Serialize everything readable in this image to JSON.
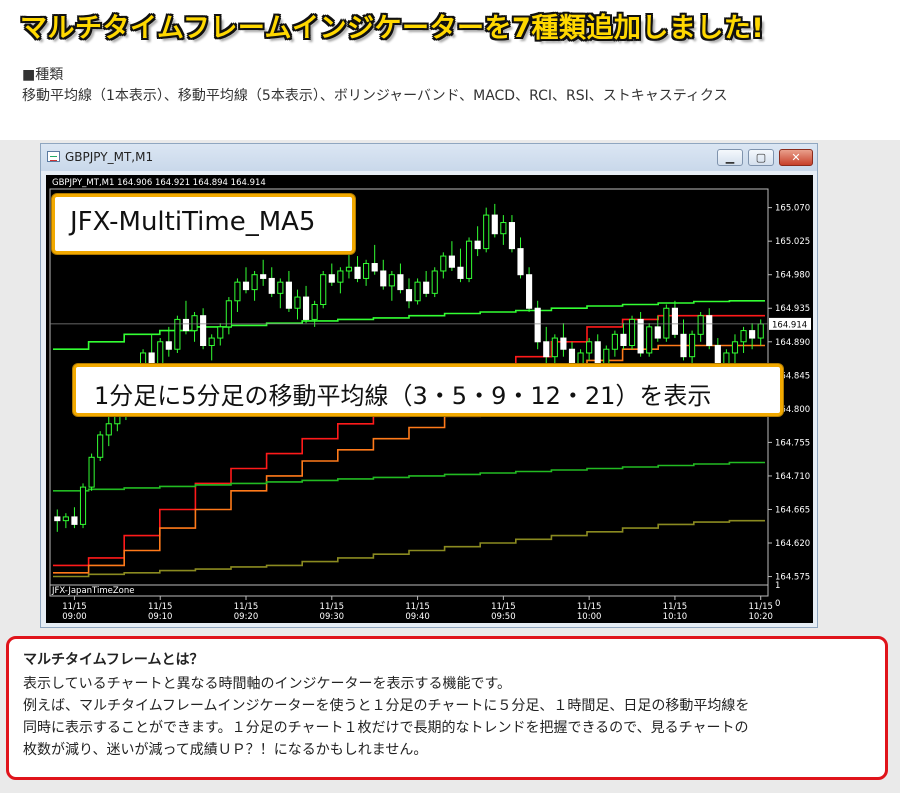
{
  "page": {
    "headline": "マルチタイムフレームインジケーターを7種類追加しました!",
    "types_heading": "■種類",
    "types_list": "移動平均線（1本表示）、移動平均線（5本表示）、ボリンジャーバンド、MACD、RCI、RSI、ストキャスティクス"
  },
  "window": {
    "title": "GBPJPY_MT,M1",
    "buttons": {
      "minimize": "▁",
      "maximize": "▢",
      "close": "✕"
    }
  },
  "callouts": {
    "indicator_name": "JFX-MultiTime_MA5",
    "description": "1分足に5分足の移動平均線（3・5・9・12・21）を表示"
  },
  "info": {
    "title": "マルチタイムフレームとは？",
    "lines": [
      "表示しているチャートと異なる時間軸のインジケーターを表示する機能です。",
      "例えば、マルチタイムフレームインジケーターを使うと１分足のチャートに５分足、１時間足、日足の移動平均線を",
      "同時に表示することができます。１分足のチャート１枚だけで長期的なトレンドを把握できるので、見るチャートの",
      "枚数が減り、迷いが減って成績ＵＰ？！になるかもしれません。"
    ]
  },
  "chart_data": {
    "type": "candlestick",
    "symbol_header": "GBPJPY_MT,M1  164.906 164.921 164.894 164.914",
    "sub_window_label": "JFX-JapanTimeZone",
    "ylim": [
      164.565,
      165.095
    ],
    "y_ticks": [
      "165.070",
      "165.025",
      "164.980",
      "164.935",
      "164.890",
      "164.845",
      "164.800",
      "164.755",
      "164.710",
      "164.665",
      "164.620",
      "164.575"
    ],
    "sub_ticks": [
      "1",
      "0"
    ],
    "current_price": "164.914",
    "x_ticks": [
      {
        "date": "11/15",
        "time": "09:00"
      },
      {
        "date": "11/15",
        "time": "09:10"
      },
      {
        "date": "11/15",
        "time": "09:20"
      },
      {
        "date": "11/15",
        "time": "09:30"
      },
      {
        "date": "11/15",
        "time": "09:40"
      },
      {
        "date": "11/15",
        "time": "09:50"
      },
      {
        "date": "11/15",
        "time": "10:00"
      },
      {
        "date": "11/15",
        "time": "10:10"
      },
      {
        "date": "11/15",
        "time": "10:20"
      }
    ],
    "candles": [
      [
        164.655,
        164.665,
        164.635,
        164.65
      ],
      [
        164.65,
        164.66,
        164.64,
        164.655
      ],
      [
        164.655,
        164.668,
        164.64,
        164.645
      ],
      [
        164.645,
        164.7,
        164.64,
        164.695
      ],
      [
        164.695,
        164.74,
        164.69,
        164.735
      ],
      [
        164.735,
        164.77,
        164.73,
        164.765
      ],
      [
        164.765,
        164.79,
        164.75,
        164.78
      ],
      [
        164.78,
        164.8,
        164.77,
        164.79
      ],
      [
        164.79,
        164.83,
        164.785,
        164.825
      ],
      [
        164.825,
        164.845,
        164.81,
        164.835
      ],
      [
        164.835,
        164.88,
        164.83,
        164.875
      ],
      [
        164.875,
        164.9,
        164.85,
        164.86
      ],
      [
        164.86,
        164.895,
        164.85,
        164.89
      ],
      [
        164.89,
        164.91,
        164.87,
        164.88
      ],
      [
        164.88,
        164.925,
        164.875,
        164.92
      ],
      [
        164.92,
        164.945,
        164.9,
        164.905
      ],
      [
        164.905,
        164.93,
        164.89,
        164.925
      ],
      [
        164.925,
        164.935,
        164.88,
        164.885
      ],
      [
        164.885,
        164.9,
        164.865,
        164.895
      ],
      [
        164.895,
        164.915,
        164.885,
        164.91
      ],
      [
        164.91,
        164.95,
        164.9,
        164.945
      ],
      [
        164.945,
        164.975,
        164.93,
        164.97
      ],
      [
        164.97,
        164.99,
        164.955,
        164.96
      ],
      [
        164.96,
        164.985,
        164.945,
        164.98
      ],
      [
        164.98,
        165.0,
        164.965,
        164.975
      ],
      [
        164.975,
        164.99,
        164.95,
        164.955
      ],
      [
        164.955,
        164.975,
        164.935,
        164.97
      ],
      [
        164.97,
        164.985,
        164.93,
        164.935
      ],
      [
        164.935,
        164.96,
        164.92,
        164.95
      ],
      [
        164.95,
        164.965,
        164.915,
        164.92
      ],
      [
        164.92,
        164.945,
        164.91,
        164.94
      ],
      [
        164.94,
        164.985,
        164.935,
        164.98
      ],
      [
        164.98,
        164.995,
        164.965,
        164.97
      ],
      [
        164.97,
        164.99,
        164.955,
        164.985
      ],
      [
        164.985,
        165.01,
        164.975,
        164.99
      ],
      [
        164.99,
        165.005,
        164.97,
        164.975
      ],
      [
        164.975,
        165.0,
        164.965,
        164.995
      ],
      [
        164.995,
        165.02,
        164.98,
        164.985
      ],
      [
        164.985,
        165.0,
        164.96,
        164.965
      ],
      [
        164.965,
        164.985,
        164.945,
        164.98
      ],
      [
        164.98,
        164.995,
        164.955,
        164.96
      ],
      [
        164.96,
        164.975,
        164.935,
        164.945
      ],
      [
        164.945,
        164.975,
        164.94,
        164.97
      ],
      [
        164.97,
        164.985,
        164.95,
        164.955
      ],
      [
        164.955,
        164.99,
        164.95,
        164.985
      ],
      [
        164.985,
        165.01,
        164.975,
        165.005
      ],
      [
        165.005,
        165.025,
        164.985,
        164.99
      ],
      [
        164.99,
        165.015,
        164.97,
        164.975
      ],
      [
        164.975,
        165.03,
        164.97,
        165.025
      ],
      [
        165.025,
        165.045,
        165.005,
        165.015
      ],
      [
        165.015,
        165.07,
        165.01,
        165.06
      ],
      [
        165.06,
        165.075,
        165.03,
        165.035
      ],
      [
        165.035,
        165.06,
        165.02,
        165.05
      ],
      [
        165.05,
        165.06,
        165.01,
        165.015
      ],
      [
        165.015,
        165.03,
        164.975,
        164.98
      ],
      [
        164.98,
        164.99,
        164.93,
        164.935
      ],
      [
        164.935,
        164.945,
        164.88,
        164.89
      ],
      [
        164.89,
        164.91,
        164.86,
        164.87
      ],
      [
        164.87,
        164.9,
        164.855,
        164.895
      ],
      [
        164.895,
        164.915,
        164.87,
        164.88
      ],
      [
        164.88,
        164.89,
        164.85,
        164.855
      ],
      [
        164.855,
        164.88,
        164.845,
        164.875
      ],
      [
        164.875,
        164.895,
        164.865,
        164.89
      ],
      [
        164.89,
        164.9,
        164.855,
        164.86
      ],
      [
        164.86,
        164.885,
        164.845,
        164.88
      ],
      [
        164.88,
        164.905,
        164.87,
        164.9
      ],
      [
        164.9,
        164.915,
        164.88,
        164.885
      ],
      [
        164.885,
        164.925,
        164.88,
        164.92
      ],
      [
        164.92,
        164.93,
        164.87,
        164.875
      ],
      [
        164.875,
        164.915,
        164.87,
        164.91
      ],
      [
        164.91,
        164.925,
        164.89,
        164.895
      ],
      [
        164.895,
        164.94,
        164.89,
        164.935
      ],
      [
        164.935,
        164.945,
        164.895,
        164.9
      ],
      [
        164.9,
        164.92,
        164.865,
        164.87
      ],
      [
        164.87,
        164.905,
        164.86,
        164.9
      ],
      [
        164.9,
        164.93,
        164.89,
        164.925
      ],
      [
        164.925,
        164.935,
        164.88,
        164.885
      ],
      [
        164.885,
        164.895,
        164.855,
        164.86
      ],
      [
        164.86,
        164.88,
        164.82,
        164.875
      ],
      [
        164.875,
        164.9,
        164.86,
        164.89
      ],
      [
        164.89,
        164.91,
        164.875,
        164.905
      ],
      [
        164.905,
        164.915,
        164.88,
        164.895
      ],
      [
        164.895,
        164.92,
        164.885,
        164.914
      ]
    ],
    "series": [
      {
        "color": "#ff1a1a",
        "values": [
          164.59,
          164.6,
          164.63,
          164.665,
          164.7,
          164.72,
          164.74,
          164.76,
          164.78,
          164.79,
          164.81,
          164.83,
          164.85,
          164.87,
          164.89,
          164.91,
          164.92,
          164.925,
          164.925,
          164.925
        ]
      },
      {
        "color": "#ff7a1a",
        "values": [
          164.58,
          164.59,
          164.61,
          164.64,
          164.665,
          164.69,
          164.71,
          164.73,
          164.745,
          164.76,
          164.775,
          164.79,
          164.81,
          164.83,
          164.85,
          164.865,
          164.88,
          164.885,
          164.885,
          164.885
        ]
      },
      {
        "color": "#33ff33",
        "values": [
          164.88,
          164.89,
          164.9,
          164.905,
          164.91,
          164.912,
          164.915,
          164.918,
          164.92,
          164.922,
          164.925,
          164.928,
          164.93,
          164.932,
          164.935,
          164.938,
          164.94,
          164.942,
          164.944,
          164.945
        ]
      },
      {
        "color": "#22bb22",
        "values": [
          164.69,
          164.692,
          164.694,
          164.696,
          164.698,
          164.7,
          164.702,
          164.704,
          164.706,
          164.708,
          164.71,
          164.712,
          164.714,
          164.716,
          164.718,
          164.72,
          164.722,
          164.724,
          164.726,
          164.728
        ]
      },
      {
        "color": "#8a8a20",
        "values": [
          164.575,
          164.578,
          164.58,
          164.583,
          164.585,
          164.588,
          164.59,
          164.595,
          164.6,
          164.605,
          164.61,
          164.615,
          164.62,
          164.625,
          164.63,
          164.635,
          164.64,
          164.645,
          164.648,
          164.65
        ]
      }
    ]
  }
}
